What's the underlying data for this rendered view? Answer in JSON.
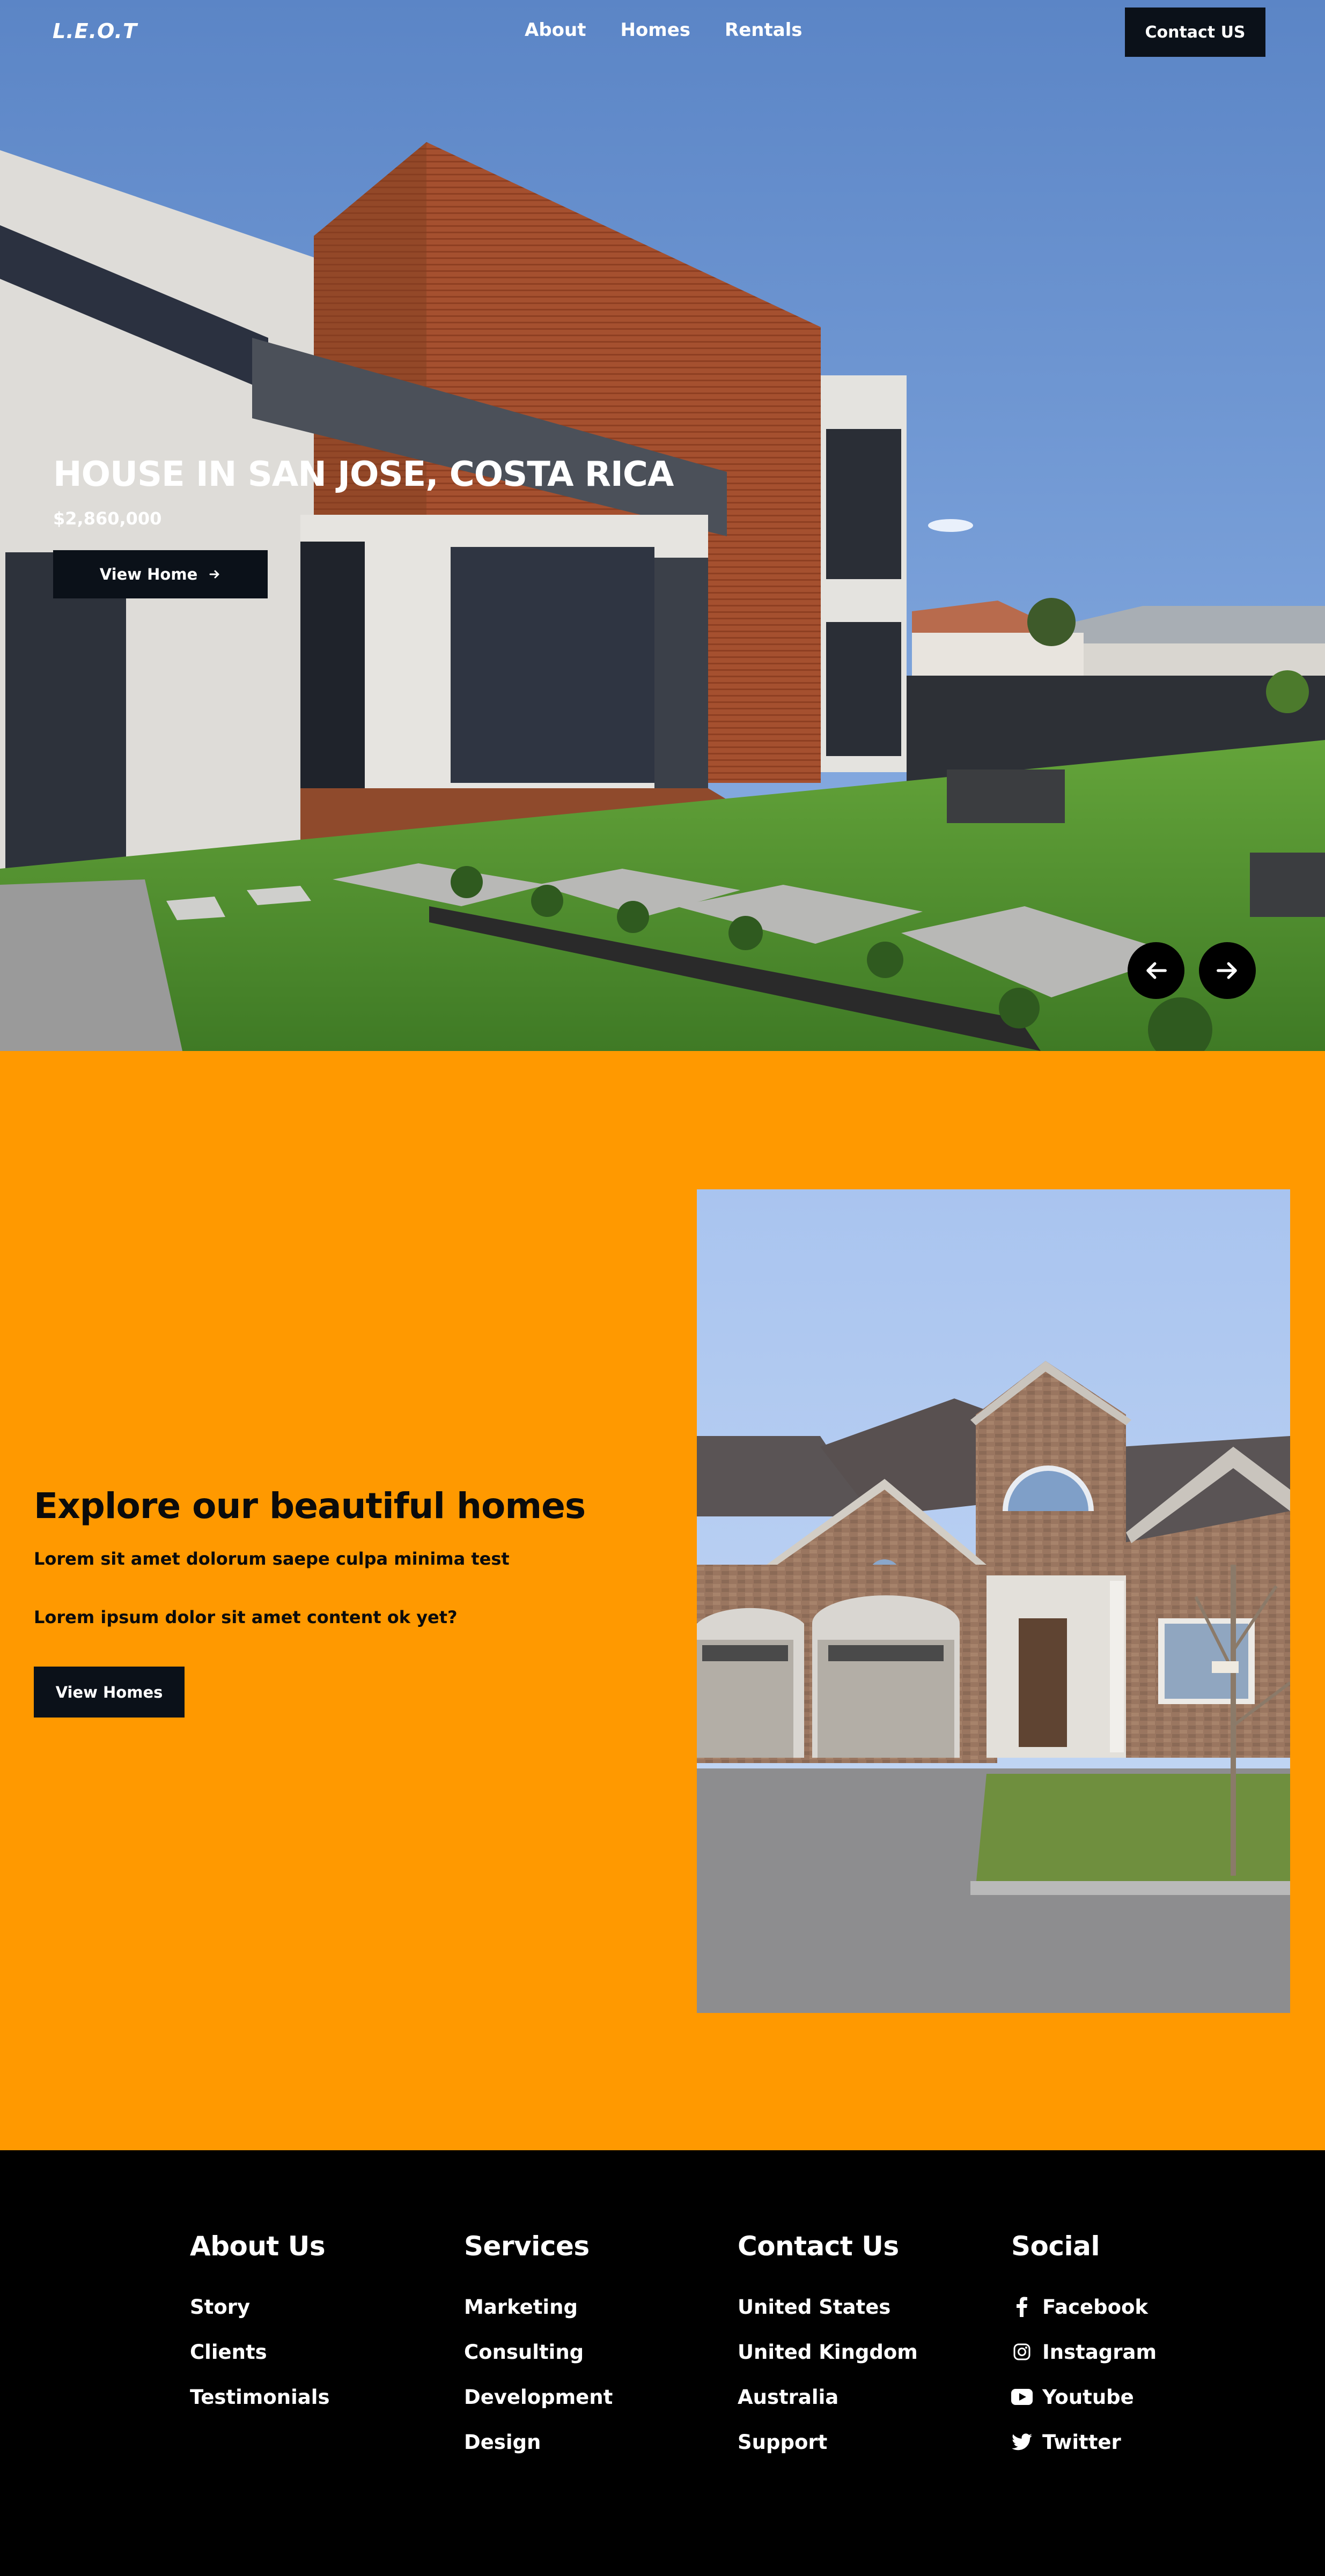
{
  "nav": {
    "logo": "L.E.O.T",
    "links": [
      "About",
      "Homes",
      "Rentals"
    ],
    "cta": "Contact US"
  },
  "hero": {
    "title": "HOUSE IN SAN JOSE, COSTA RICA",
    "price": "$2,860,000",
    "button": "View Home"
  },
  "explore": {
    "title": "Explore our beautiful homes",
    "line1": "Lorem sit amet dolorum saepe culpa minima test",
    "line2": "Lorem ipsum dolor sit amet content ok yet?",
    "button": "View Homes"
  },
  "footer": {
    "about": {
      "title": "About Us",
      "items": [
        "Story",
        "Clients",
        "Testimonials"
      ]
    },
    "services": {
      "title": "Services",
      "items": [
        "Marketing",
        "Consulting",
        "Development",
        "Design"
      ]
    },
    "contact": {
      "title": "Contact Us",
      "items": [
        "United States",
        "United Kingdom",
        "Australia",
        "Support"
      ]
    },
    "social": {
      "title": "Social",
      "items": [
        {
          "label": "Facebook",
          "icon": "facebook-icon"
        },
        {
          "label": "Instagram",
          "icon": "instagram-icon"
        },
        {
          "label": "Youtube",
          "icon": "youtube-icon"
        },
        {
          "label": "Twitter",
          "icon": "twitter-icon"
        }
      ]
    }
  },
  "colors": {
    "accent": "#ff9900",
    "dark_button": "#0b1119",
    "footer_bg": "#000000"
  }
}
